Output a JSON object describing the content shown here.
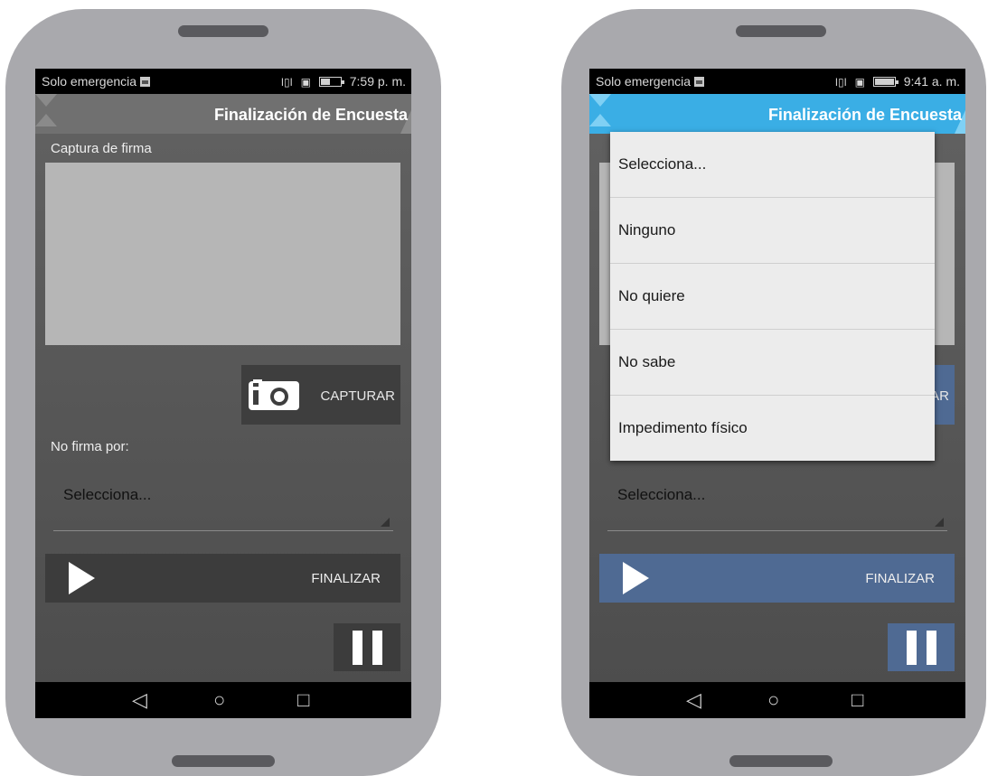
{
  "left": {
    "status": {
      "carrier": "Solo emergencia",
      "time": "7:59 p. m.",
      "battery_level": 0.45
    },
    "appbar": {
      "title": "Finalización de Encuesta",
      "color": "#707070"
    },
    "signature_label": "Captura de firma",
    "capture_label": "CAPTURAR",
    "no_sign_label": "No firma por:",
    "select_value": "Selecciona...",
    "finish_label": "FINALIZAR"
  },
  "right": {
    "status": {
      "carrier": "Solo emergencia",
      "time": "9:41 a. m.",
      "battery_level": 1.0
    },
    "appbar": {
      "title": "Finalización de Encuesta",
      "color": "#3aaee5"
    },
    "capture_label_partial": "AR",
    "select_value": "Selecciona...",
    "finish_label": "FINALIZAR",
    "dropdown_options": [
      "Selecciona...",
      "Ninguno",
      "No quiere",
      "No sabe",
      "Impedimento físico"
    ]
  },
  "colors": {
    "accent_blue": "#4f6a93",
    "header_blue": "#3aaee5"
  },
  "icons": {
    "camera": "camera-icon",
    "play": "play-icon",
    "pause": "pause-icon",
    "back": "nav-back-icon",
    "home": "nav-home-icon",
    "recents": "nav-recents-icon"
  }
}
